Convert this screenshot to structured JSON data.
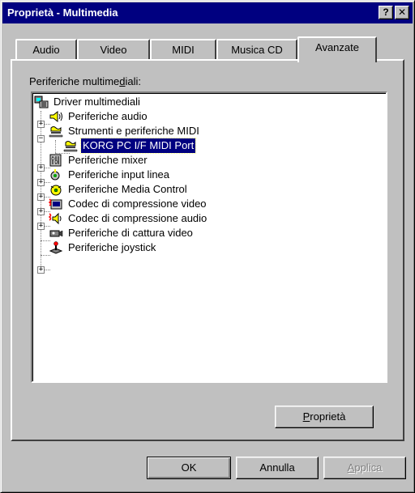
{
  "window": {
    "title": "Proprietà - Multimedia",
    "help_label": "?",
    "close_label": "✕"
  },
  "tabs": [
    {
      "label": "Audio"
    },
    {
      "label": "Video"
    },
    {
      "label": "MIDI"
    },
    {
      "label": "Musica CD"
    },
    {
      "label": "Avanzate"
    }
  ],
  "panel": {
    "label_pre": "Periferiche multime",
    "label_accel": "d",
    "label_post": "iali:"
  },
  "tree": {
    "items": [
      {
        "label": "Driver multimediali",
        "icon": "multimedia-drivers-icon"
      },
      {
        "label": "Periferiche audio",
        "icon": "speaker-icon"
      },
      {
        "label": "Strumenti e periferiche MIDI",
        "icon": "midi-icon"
      },
      {
        "label": "KORG PC I/F MIDI Port",
        "icon": "midi-icon"
      },
      {
        "label": "Periferiche mixer",
        "icon": "mixer-icon"
      },
      {
        "label": "Periferiche input linea",
        "icon": "line-input-icon"
      },
      {
        "label": "Periferiche Media Control",
        "icon": "media-control-icon"
      },
      {
        "label": "Codec di compressione video",
        "icon": "video-codec-icon"
      },
      {
        "label": "Codec di compressione audio",
        "icon": "audio-codec-icon"
      },
      {
        "label": "Periferiche di cattura video",
        "icon": "video-capture-icon"
      },
      {
        "label": "Periferiche joystick",
        "icon": "joystick-icon"
      }
    ]
  },
  "buttons": {
    "properties_accel": "P",
    "properties_rest": "roprietà",
    "ok": "OK",
    "cancel": "Annulla",
    "apply_accel": "A",
    "apply_rest": "pplica"
  },
  "colors": {
    "titlebar": "#000080",
    "selection": "#000080",
    "face": "#c0c0c0"
  }
}
